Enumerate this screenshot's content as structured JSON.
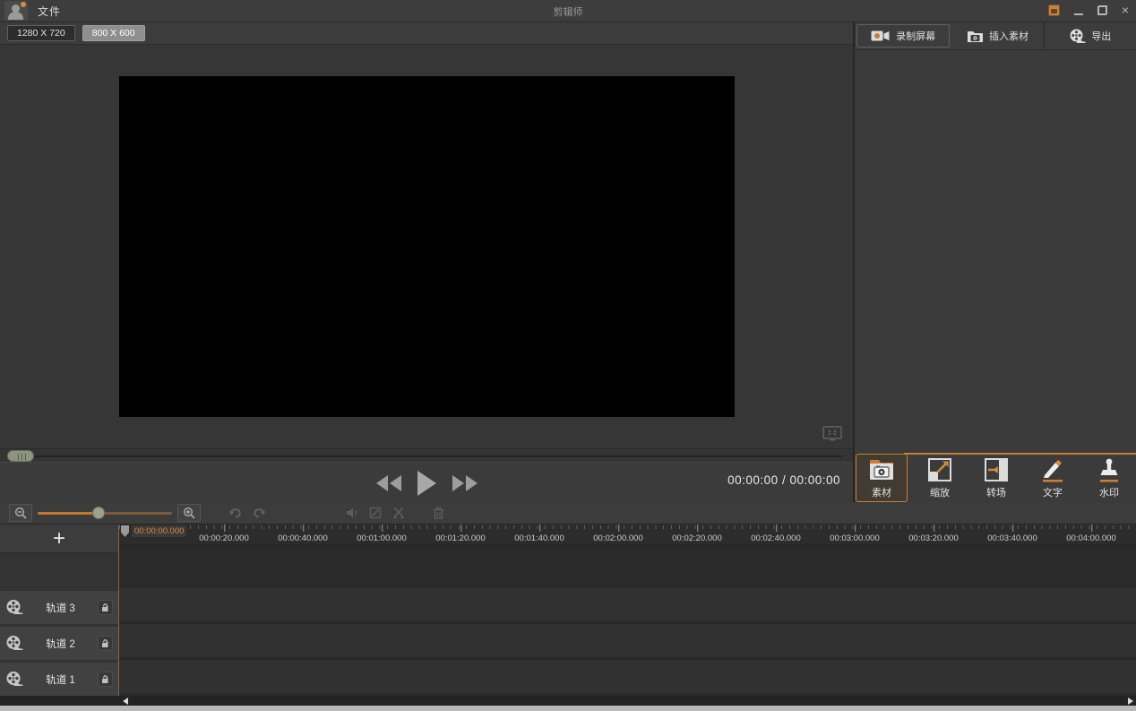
{
  "colors": {
    "accent": "#c87f35",
    "orange": "#d98a3c",
    "panel_dark": "#3b3b3b",
    "ruler_bg": "#2c2c2c"
  },
  "titlebar": {
    "file_menu": "文件",
    "app_title": "剪辑师",
    "minimize": "",
    "close": "×"
  },
  "resolution_bar": {
    "options": [
      {
        "label": "1280 X 720",
        "active": false
      },
      {
        "label": "800 X 600",
        "active": true
      }
    ]
  },
  "preview": {
    "time_display": "00:00:00 / 00:00:00"
  },
  "right_panel": {
    "actions": [
      {
        "label": "录制屏幕",
        "icon": "record-screen-icon"
      },
      {
        "label": "插入素材",
        "icon": "insert-material-icon"
      },
      {
        "label": "导出",
        "icon": "export-icon"
      }
    ],
    "tabs": [
      {
        "label": "素材",
        "icon": "material-icon",
        "active": true
      },
      {
        "label": "缩放",
        "icon": "scale-icon",
        "active": false
      },
      {
        "label": "转场",
        "icon": "transition-icon",
        "active": false
      },
      {
        "label": "文字",
        "icon": "text-icon",
        "active": false
      },
      {
        "label": "水印",
        "icon": "watermark-icon",
        "active": false
      }
    ]
  },
  "timeline": {
    "add_track": "+",
    "playhead_label": "00:00:00.000",
    "ruler_labels": [
      "00:00:20.000",
      "00:00:40.000",
      "00:01:00.000",
      "00:01:20.000",
      "00:01:40.000",
      "00:02:00.000",
      "00:02:20.000",
      "00:02:40.000",
      "00:03:00.000",
      "00:03:20.000",
      "00:03:40.000",
      "00:04:00.000"
    ],
    "tracks": [
      {
        "label": "轨道 3"
      },
      {
        "label": "轨道 2"
      },
      {
        "label": "轨道 1"
      }
    ]
  }
}
